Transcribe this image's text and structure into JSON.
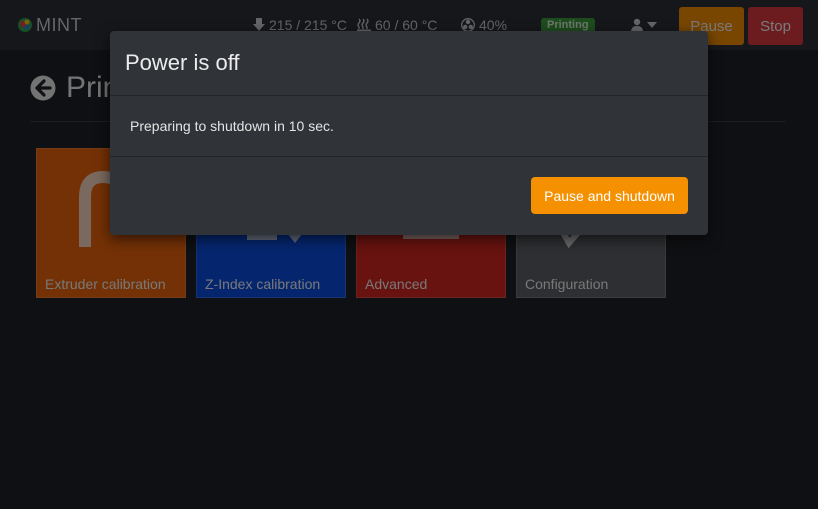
{
  "navbar": {
    "brand": "MINT",
    "extruder_temp": "215 / 215 °C",
    "bed_temp": "60 / 60 °C",
    "fan": "40%",
    "status_badge": "Printing",
    "pause_label": "Pause",
    "stop_label": "Stop"
  },
  "page": {
    "title": "Printer"
  },
  "tiles": [
    {
      "label": "Extruder calibration",
      "color": "#e8620a"
    },
    {
      "label": "Z-Index calibration",
      "color": "#0a4ddf"
    },
    {
      "label": "Advanced",
      "color": "#d0271f"
    },
    {
      "label": "Configuration",
      "color": "#5b5e64"
    }
  ],
  "modal": {
    "title": "Power is off",
    "message": "Preparing to shutdown in 10 sec.",
    "action_label": "Pause and shutdown"
  },
  "colors": {
    "accent": "#f59100",
    "danger": "#d9393e",
    "success": "#3c9a3c"
  }
}
